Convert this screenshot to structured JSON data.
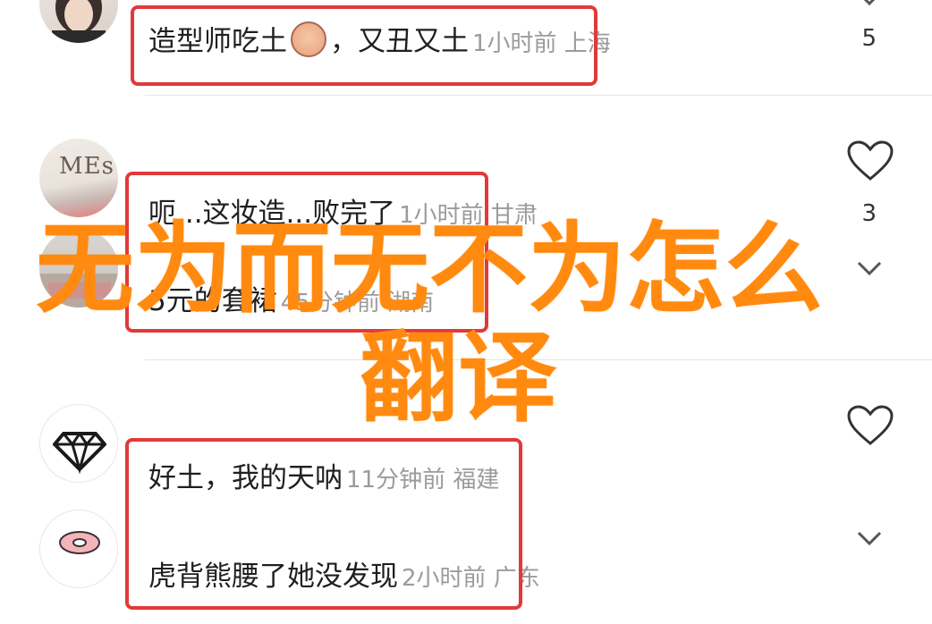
{
  "comments": [
    {
      "text": "造型师吃土",
      "text2": "，又丑又土",
      "emoji": "crying-face-emoji",
      "meta": "1小时前 上海",
      "likes": "5"
    },
    {
      "text": "呃...这妆造...败完了",
      "meta": "1小时前 甘肃",
      "likes": "3"
    },
    {
      "text": "5元的套裙",
      "meta": "45分钟前 湖南"
    },
    {
      "text": "好土，我的天呐",
      "meta": "11分钟前 福建"
    },
    {
      "text": "虎背熊腰了她没发现",
      "meta": "2小时前 广东"
    }
  ],
  "avatar2_text": "MEs",
  "overlay": {
    "line1": "无为而无不为怎么",
    "line2": "翻译"
  },
  "colors": {
    "highlight": "#e03a3a",
    "overlay": "#ff8a0f",
    "meta": "#9b9b9b"
  }
}
